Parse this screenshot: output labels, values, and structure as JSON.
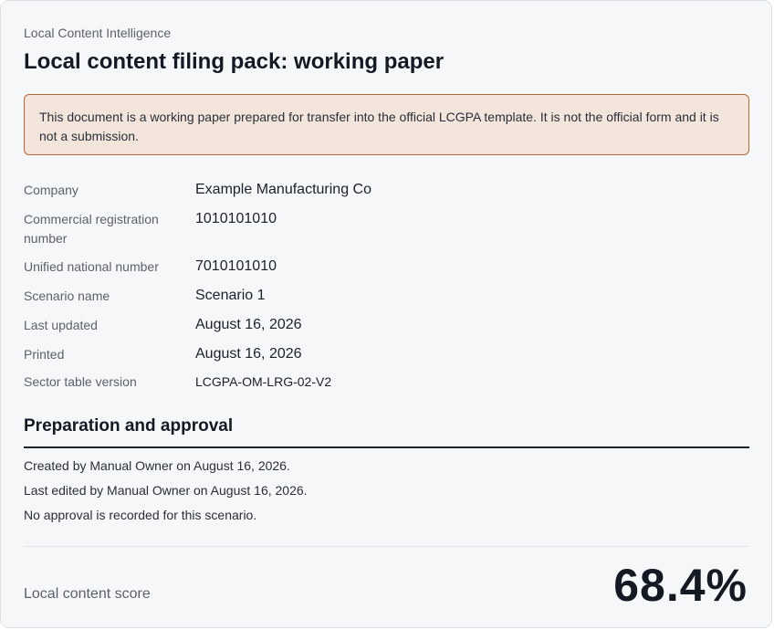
{
  "header": {
    "eyebrow": "Local Content Intelligence",
    "title": "Local content filing pack: working paper"
  },
  "notice": {
    "text": "This document is a working paper prepared for transfer into the official LCGPA template. It is not the official form and it is not a submission."
  },
  "facts": {
    "company_label": "Company",
    "company_value": "Example Manufacturing Co",
    "cr_label": "Commercial registration number",
    "cr_value": "1010101010",
    "unn_label": "Unified national number",
    "unn_value": "7010101010",
    "scenario_label": "Scenario name",
    "scenario_value": "Scenario 1",
    "updated_label": "Last updated",
    "updated_value": "August 16, 2026",
    "printed_label": "Printed",
    "printed_value": "August 16, 2026",
    "sector_label": "Sector table version",
    "sector_value": "LCGPA-OM-LRG-02-V2"
  },
  "approval": {
    "heading": "Preparation and approval",
    "created": "Created by Manual Owner on August 16, 2026.",
    "edited": "Last edited by Manual Owner on August 16, 2026.",
    "approval_status": "No approval is recorded for this scenario."
  },
  "score": {
    "label": "Local content score",
    "value": "68.4%"
  },
  "colors": {
    "notice_background": "#f3e4dc",
    "notice_border": "#b5693a",
    "card_background": "#f6f7f9"
  }
}
